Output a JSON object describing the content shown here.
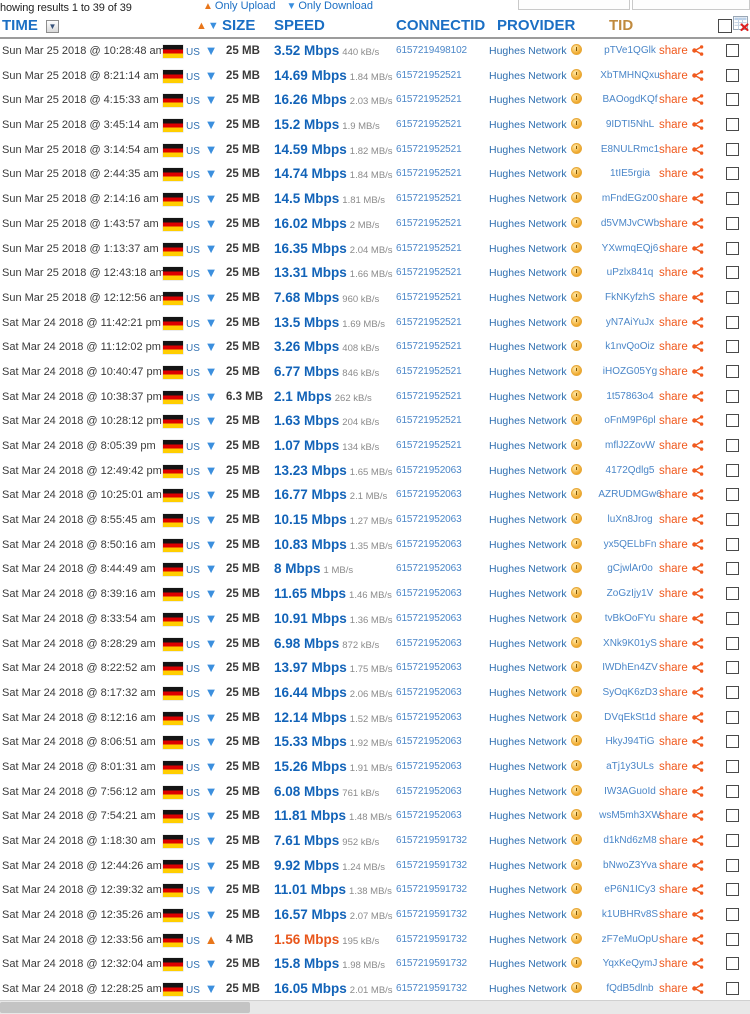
{
  "topbar": {
    "results_text": "howing results 1 to 39 of 39",
    "only_upload": "Only Upload",
    "only_download": "Only Download",
    "up_glyph": "▲",
    "down_glyph": "▼"
  },
  "header": {
    "time": "TIME",
    "size": "SIZE",
    "speed": "SPEED",
    "connectid": "CONNECTID",
    "provider": "PROVIDER",
    "tid": "TID",
    "sort_button_glyph": "▼",
    "sort_asc_glyph": "▲",
    "sort_desc_glyph": "▼",
    "export_icon_name": "export-spreadsheet-icon"
  },
  "colors": {
    "link_blue": "#1b6fc4",
    "speed_blue": "#1263b8",
    "upload_orange": "#e8561b",
    "tid_header": "#c08a3e",
    "share_orange": "#f05a1e"
  },
  "share_label": "share",
  "country_code": "US",
  "provider_name": "Hughes Network",
  "rows": [
    {
      "time": "Sun Mar 25 2018 @ 10:28:48 am",
      "dir": "down",
      "size": "25 MB",
      "speed": "3.52 Mbps",
      "rate": "440 kB/s",
      "connectid": "6157219498102",
      "tid": "pTVe1QGlk"
    },
    {
      "time": "Sun Mar 25 2018 @ 8:21:14 am",
      "dir": "down",
      "size": "25 MB",
      "speed": "14.69 Mbps",
      "rate": "1.84 MB/s",
      "connectid": "615721952521",
      "tid": "XbTMHNQxu"
    },
    {
      "time": "Sun Mar 25 2018 @ 4:15:33 am",
      "dir": "down",
      "size": "25 MB",
      "speed": "16.26 Mbps",
      "rate": "2.03 MB/s",
      "connectid": "615721952521",
      "tid": "BAOogdKQf"
    },
    {
      "time": "Sun Mar 25 2018 @ 3:45:14 am",
      "dir": "down",
      "size": "25 MB",
      "speed": "15.2 Mbps",
      "rate": "1.9 MB/s",
      "connectid": "615721952521",
      "tid": "9IDTI5NhL"
    },
    {
      "time": "Sun Mar 25 2018 @ 3:14:54 am",
      "dir": "down",
      "size": "25 MB",
      "speed": "14.59 Mbps",
      "rate": "1.82 MB/s",
      "connectid": "615721952521",
      "tid": "E8NULRmc1"
    },
    {
      "time": "Sun Mar 25 2018 @ 2:44:35 am",
      "dir": "down",
      "size": "25 MB",
      "speed": "14.74 Mbps",
      "rate": "1.84 MB/s",
      "connectid": "615721952521",
      "tid": "1tIE5rgia"
    },
    {
      "time": "Sun Mar 25 2018 @ 2:14:16 am",
      "dir": "down",
      "size": "25 MB",
      "speed": "14.5 Mbps",
      "rate": "1.81 MB/s",
      "connectid": "615721952521",
      "tid": "mFndEGz00"
    },
    {
      "time": "Sun Mar 25 2018 @ 1:43:57 am",
      "dir": "down",
      "size": "25 MB",
      "speed": "16.02 Mbps",
      "rate": "2 MB/s",
      "connectid": "615721952521",
      "tid": "d5VMJvCWb"
    },
    {
      "time": "Sun Mar 25 2018 @ 1:13:37 am",
      "dir": "down",
      "size": "25 MB",
      "speed": "16.35 Mbps",
      "rate": "2.04 MB/s",
      "connectid": "615721952521",
      "tid": "YXwmqEQj6"
    },
    {
      "time": "Sun Mar 25 2018 @ 12:43:18 am",
      "dir": "down",
      "size": "25 MB",
      "speed": "13.31 Mbps",
      "rate": "1.66 MB/s",
      "connectid": "615721952521",
      "tid": "uPzlx841q"
    },
    {
      "time": "Sun Mar 25 2018 @ 12:12:56 am",
      "dir": "down",
      "size": "25 MB",
      "speed": "7.68 Mbps",
      "rate": "960 kB/s",
      "connectid": "615721952521",
      "tid": "FkNKyfzhS"
    },
    {
      "time": "Sat Mar 24 2018 @ 11:42:21 pm",
      "dir": "down",
      "size": "25 MB",
      "speed": "13.5 Mbps",
      "rate": "1.69 MB/s",
      "connectid": "615721952521",
      "tid": "yN7AiYuJx"
    },
    {
      "time": "Sat Mar 24 2018 @ 11:12:02 pm",
      "dir": "down",
      "size": "25 MB",
      "speed": "3.26 Mbps",
      "rate": "408 kB/s",
      "connectid": "615721952521",
      "tid": "k1nvQoOiz"
    },
    {
      "time": "Sat Mar 24 2018 @ 10:40:47 pm",
      "dir": "down",
      "size": "25 MB",
      "speed": "6.77 Mbps",
      "rate": "846 kB/s",
      "connectid": "615721952521",
      "tid": "iHOZG05Yg"
    },
    {
      "time": "Sat Mar 24 2018 @ 10:38:37 pm",
      "dir": "down",
      "size": "6.3 MB",
      "speed": "2.1 Mbps",
      "rate": "262 kB/s",
      "connectid": "615721952521",
      "tid": "1t57863o4"
    },
    {
      "time": "Sat Mar 24 2018 @ 10:28:12 pm",
      "dir": "down",
      "size": "25 MB",
      "speed": "1.63 Mbps",
      "rate": "204 kB/s",
      "connectid": "615721952521",
      "tid": "oFnM9P6pl"
    },
    {
      "time": "Sat Mar 24 2018 @ 8:05:39 pm",
      "dir": "down",
      "size": "25 MB",
      "speed": "1.07 Mbps",
      "rate": "134 kB/s",
      "connectid": "615721952521",
      "tid": "mflJ2ZovW"
    },
    {
      "time": "Sat Mar 24 2018 @ 12:49:42 pm",
      "dir": "down",
      "size": "25 MB",
      "speed": "13.23 Mbps",
      "rate": "1.65 MB/s",
      "connectid": "615721952063",
      "tid": "4172Qdlg5"
    },
    {
      "time": "Sat Mar 24 2018 @ 10:25:01 am",
      "dir": "down",
      "size": "25 MB",
      "speed": "16.77 Mbps",
      "rate": "2.1 MB/s",
      "connectid": "615721952063",
      "tid": "AZRUDMGw6"
    },
    {
      "time": "Sat Mar 24 2018 @ 8:55:45 am",
      "dir": "down",
      "size": "25 MB",
      "speed": "10.15 Mbps",
      "rate": "1.27 MB/s",
      "connectid": "615721952063",
      "tid": "luXn8Jrog"
    },
    {
      "time": "Sat Mar 24 2018 @ 8:50:16 am",
      "dir": "down",
      "size": "25 MB",
      "speed": "10.83 Mbps",
      "rate": "1.35 MB/s",
      "connectid": "615721952063",
      "tid": "yx5QELbFn"
    },
    {
      "time": "Sat Mar 24 2018 @ 8:44:49 am",
      "dir": "down",
      "size": "25 MB",
      "speed": "8 Mbps",
      "rate": "1 MB/s",
      "connectid": "615721952063",
      "tid": "gCjwlAr0o"
    },
    {
      "time": "Sat Mar 24 2018 @ 8:39:16 am",
      "dir": "down",
      "size": "25 MB",
      "speed": "11.65 Mbps",
      "rate": "1.46 MB/s",
      "connectid": "615721952063",
      "tid": "ZoGzIjy1V"
    },
    {
      "time": "Sat Mar 24 2018 @ 8:33:54 am",
      "dir": "down",
      "size": "25 MB",
      "speed": "10.91 Mbps",
      "rate": "1.36 MB/s",
      "connectid": "615721952063",
      "tid": "tvBkOoFYu"
    },
    {
      "time": "Sat Mar 24 2018 @ 8:28:29 am",
      "dir": "down",
      "size": "25 MB",
      "speed": "6.98 Mbps",
      "rate": "872 kB/s",
      "connectid": "615721952063",
      "tid": "XNk9K01yS"
    },
    {
      "time": "Sat Mar 24 2018 @ 8:22:52 am",
      "dir": "down",
      "size": "25 MB",
      "speed": "13.97 Mbps",
      "rate": "1.75 MB/s",
      "connectid": "615721952063",
      "tid": "IWDhEn4ZV"
    },
    {
      "time": "Sat Mar 24 2018 @ 8:17:32 am",
      "dir": "down",
      "size": "25 MB",
      "speed": "16.44 Mbps",
      "rate": "2.06 MB/s",
      "connectid": "615721952063",
      "tid": "SyOqK6zD3"
    },
    {
      "time": "Sat Mar 24 2018 @ 8:12:16 am",
      "dir": "down",
      "size": "25 MB",
      "speed": "12.14 Mbps",
      "rate": "1.52 MB/s",
      "connectid": "615721952063",
      "tid": "DVqEkSt1d"
    },
    {
      "time": "Sat Mar 24 2018 @ 8:06:51 am",
      "dir": "down",
      "size": "25 MB",
      "speed": "15.33 Mbps",
      "rate": "1.92 MB/s",
      "connectid": "615721952063",
      "tid": "HkyJ94TiG"
    },
    {
      "time": "Sat Mar 24 2018 @ 8:01:31 am",
      "dir": "down",
      "size": "25 MB",
      "speed": "15.26 Mbps",
      "rate": "1.91 MB/s",
      "connectid": "615721952063",
      "tid": "aTj1y3ULs"
    },
    {
      "time": "Sat Mar 24 2018 @ 7:56:12 am",
      "dir": "down",
      "size": "25 MB",
      "speed": "6.08 Mbps",
      "rate": "761 kB/s",
      "connectid": "615721952063",
      "tid": "IW3AGuoId"
    },
    {
      "time": "Sat Mar 24 2018 @ 7:54:21 am",
      "dir": "down",
      "size": "25 MB",
      "speed": "11.81 Mbps",
      "rate": "1.48 MB/s",
      "connectid": "615721952063",
      "tid": "wsM5mh3XW"
    },
    {
      "time": "Sat Mar 24 2018 @ 1:18:30 am",
      "dir": "down",
      "size": "25 MB",
      "speed": "7.61 Mbps",
      "rate": "952 kB/s",
      "connectid": "6157219591732",
      "tid": "d1kNd6zM8"
    },
    {
      "time": "Sat Mar 24 2018 @ 12:44:26 am",
      "dir": "down",
      "size": "25 MB",
      "speed": "9.92 Mbps",
      "rate": "1.24 MB/s",
      "connectid": "6157219591732",
      "tid": "bNwoZ3Yva"
    },
    {
      "time": "Sat Mar 24 2018 @ 12:39:32 am",
      "dir": "down",
      "size": "25 MB",
      "speed": "11.01 Mbps",
      "rate": "1.38 MB/s",
      "connectid": "6157219591732",
      "tid": "eP6N1ICy3"
    },
    {
      "time": "Sat Mar 24 2018 @ 12:35:26 am",
      "dir": "down",
      "size": "25 MB",
      "speed": "16.57 Mbps",
      "rate": "2.07 MB/s",
      "connectid": "6157219591732",
      "tid": "k1UBHRv8S"
    },
    {
      "time": "Sat Mar 24 2018 @ 12:33:56 am",
      "dir": "up",
      "size": "4 MB",
      "speed": "1.56 Mbps",
      "rate": "195 kB/s",
      "connectid": "6157219591732",
      "tid": "zF7eMuOpU"
    },
    {
      "time": "Sat Mar 24 2018 @ 12:32:04 am",
      "dir": "down",
      "size": "25 MB",
      "speed": "15.8 Mbps",
      "rate": "1.98 MB/s",
      "connectid": "6157219591732",
      "tid": "YqxKeQymJ"
    },
    {
      "time": "Sat Mar 24 2018 @ 12:28:25 am",
      "dir": "down",
      "size": "25 MB",
      "speed": "16.05 Mbps",
      "rate": "2.01 MB/s",
      "connectid": "6157219591732",
      "tid": "fQdB5dlnb"
    }
  ]
}
